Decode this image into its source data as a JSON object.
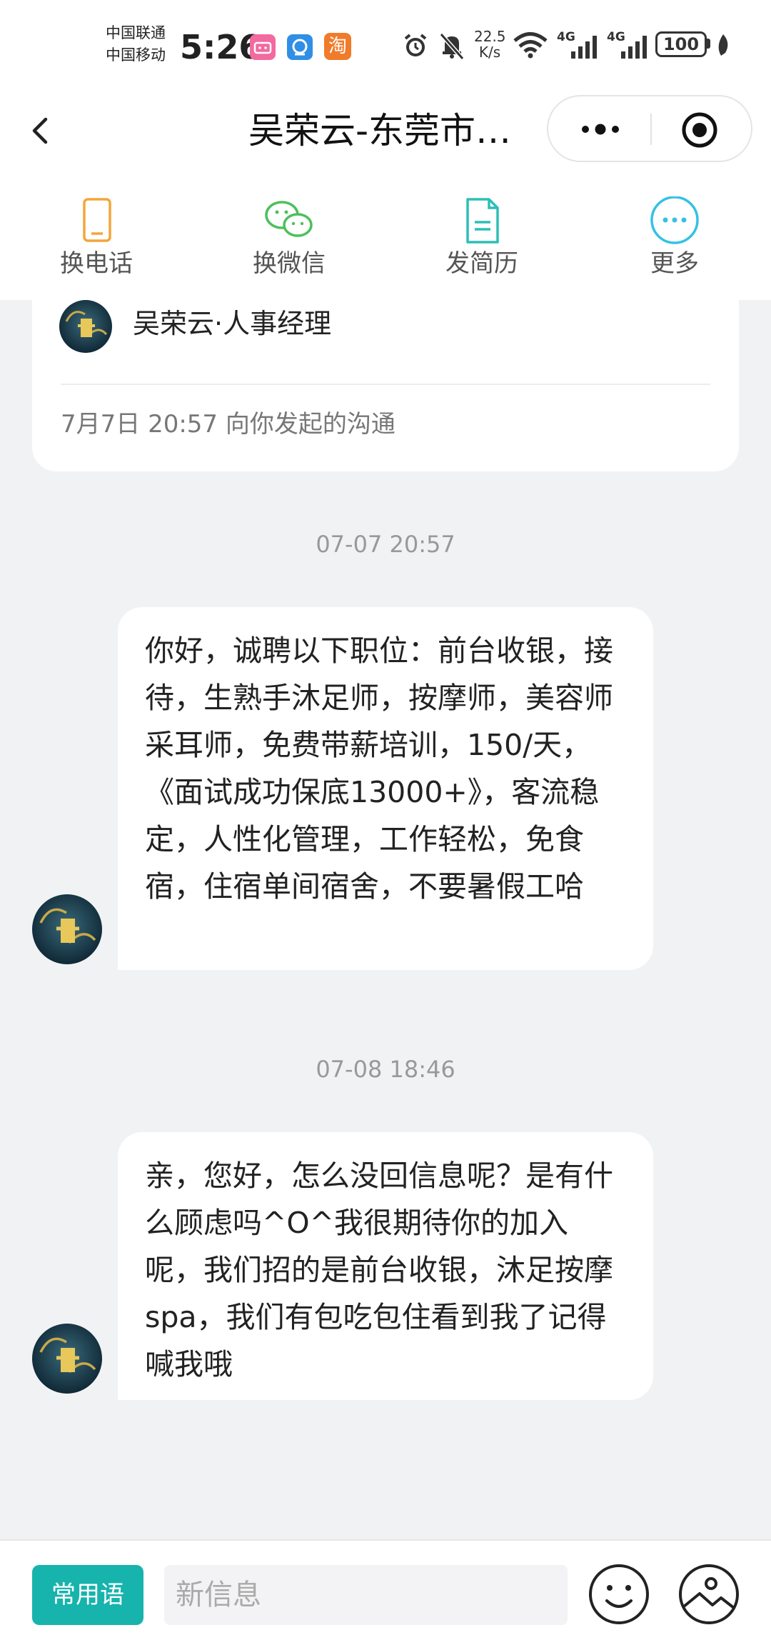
{
  "status_bar": {
    "carrier_1": "中国联通",
    "carrier_2": "中国移动",
    "time": "5:26",
    "app_badge_taobao": "淘",
    "net_speed_value": "22.5",
    "net_speed_unit": "K/s",
    "signal_1": "4G",
    "signal_2": "4G",
    "battery": "100"
  },
  "nav": {
    "title": "吴荣云-东莞市…",
    "icons": [
      "back-icon",
      "more-dots-icon",
      "close-target-icon"
    ]
  },
  "actions": [
    {
      "label": "换电话",
      "icon": "phone-icon",
      "color": "#f3a63b"
    },
    {
      "label": "换微信",
      "icon": "wechat-icon",
      "color": "#4cc05b"
    },
    {
      "label": "发简历",
      "icon": "resume-icon",
      "color": "#2dbfb6"
    },
    {
      "label": "更多",
      "icon": "more-icon",
      "color": "#35c1e6"
    }
  ],
  "card": {
    "name": "吴荣云·人事经理",
    "meta": "7月7日 20:57 向你发起的沟通"
  },
  "chat": {
    "timestamp_1": "07-07 20:57",
    "message_1": "你好，诚聘以下职位：前台收银，接待，生熟手沐足师，按摩师，美容师采耳师，免费带薪培训，150/天，《面试成功保底13000+》，客流稳定，人性化管理，工作轻松，免食宿，住宿单间宿舍，不要暑假工哈",
    "timestamp_2": "07-08 18:46",
    "message_2": "亲，您好，怎么没回信息呢？是有什么顾虑吗^O^我很期待你的加入呢，我们招的是前台收银，沐足按摩spa，我们有包吃包住看到我了记得喊我哦"
  },
  "input_bar": {
    "phrase_button": "常用语",
    "placeholder": "新信息",
    "icons": [
      "emoji-icon",
      "image-icon"
    ]
  },
  "colors": {
    "accent": "#17b3ad",
    "background": "#f1f2f4"
  }
}
